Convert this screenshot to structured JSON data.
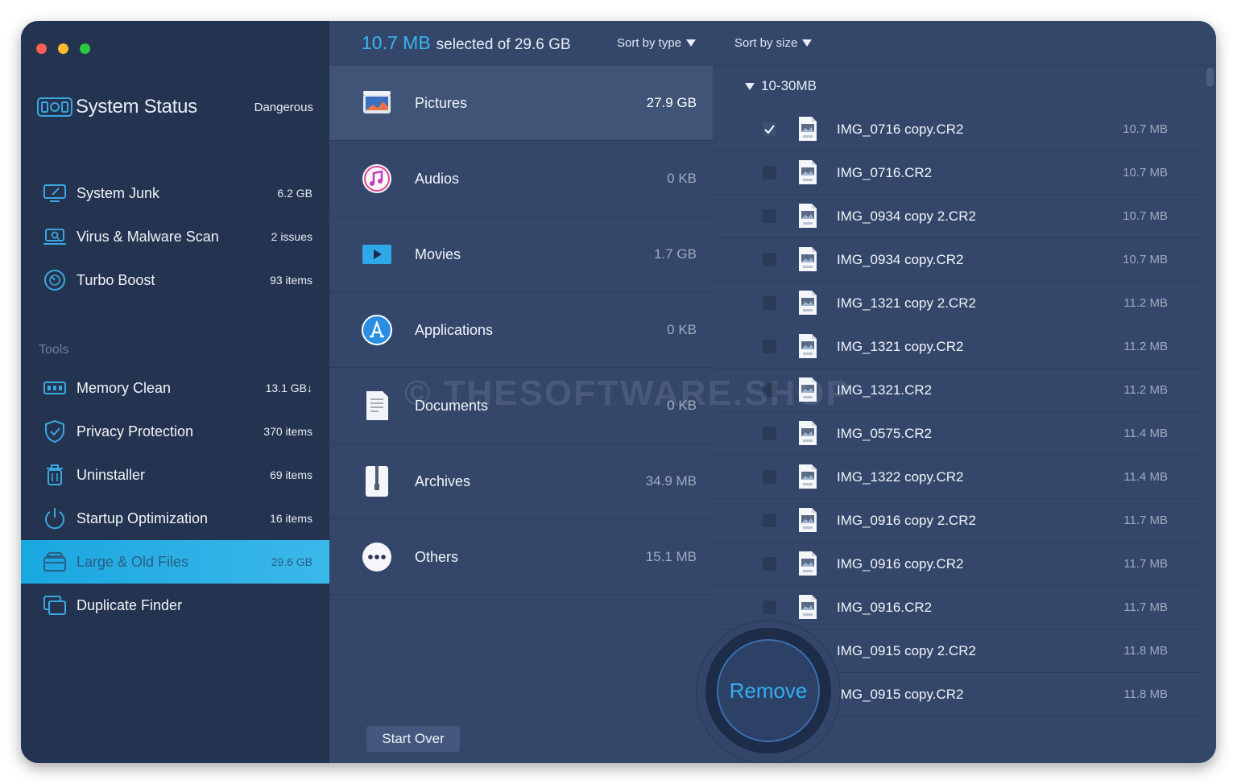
{
  "window": {
    "traffic_lights": [
      "close",
      "minimize",
      "zoom"
    ]
  },
  "sidebar": {
    "status": {
      "title": "System Status",
      "badge": "Dangerous",
      "icon": "status-icon"
    },
    "top_items": [
      {
        "label": "System Junk",
        "value": "6.2 GB",
        "icon": "monitor-broom-icon"
      },
      {
        "label": "Virus & Malware Scan",
        "value": "2 issues",
        "icon": "laptop-scan-icon"
      },
      {
        "label": "Turbo Boost",
        "value": "93 items",
        "icon": "speedometer-icon"
      }
    ],
    "tools_heading": "Tools",
    "tools": [
      {
        "label": "Memory Clean",
        "value": "13.1 GB↓",
        "icon": "memory-chip-icon"
      },
      {
        "label": "Privacy Protection",
        "value": "370 items",
        "icon": "shield-check-icon"
      },
      {
        "label": "Uninstaller",
        "value": "69 items",
        "icon": "trash-icon"
      },
      {
        "label": "Startup Optimization",
        "value": "16 items",
        "icon": "power-icon"
      },
      {
        "label": "Large & Old Files",
        "value": "29.6 GB",
        "icon": "file-box-icon",
        "active": true
      },
      {
        "label": "Duplicate Finder",
        "value": "",
        "icon": "duplicate-folder-icon"
      }
    ]
  },
  "summary": {
    "selected": "10.7 MB",
    "text": "selected of 29.6 GB"
  },
  "sort_type_label": "Sort by type",
  "sort_size_label": "Sort by size",
  "categories": [
    {
      "label": "Pictures",
      "size": "27.9 GB",
      "icon": "pictures-icon",
      "active": true
    },
    {
      "label": "Audios",
      "size": "0 KB",
      "icon": "music-icon"
    },
    {
      "label": "Movies",
      "size": "1.7 GB",
      "icon": "movie-play-icon"
    },
    {
      "label": "Applications",
      "size": "0 KB",
      "icon": "app-store-icon"
    },
    {
      "label": "Documents",
      "size": "0 KB",
      "icon": "document-icon"
    },
    {
      "label": "Archives",
      "size": "34.9 MB",
      "icon": "archive-zip-icon"
    },
    {
      "label": "Others",
      "size": "15.1 MB",
      "icon": "more-dots-icon"
    }
  ],
  "group_label": "10-30MB",
  "files": [
    {
      "name": "IMG_0716 copy.CR2",
      "size": "10.7 MB",
      "checked": true
    },
    {
      "name": "IMG_0716.CR2",
      "size": "10.7 MB",
      "checked": false
    },
    {
      "name": "IMG_0934 copy 2.CR2",
      "size": "10.7 MB",
      "checked": false
    },
    {
      "name": "IMG_0934 copy.CR2",
      "size": "10.7 MB",
      "checked": false
    },
    {
      "name": "IMG_1321 copy 2.CR2",
      "size": "11.2 MB",
      "checked": false
    },
    {
      "name": "IMG_1321 copy.CR2",
      "size": "11.2 MB",
      "checked": false
    },
    {
      "name": "IMG_1321.CR2",
      "size": "11.2 MB",
      "checked": false
    },
    {
      "name": "IMG_0575.CR2",
      "size": "11.4 MB",
      "checked": false
    },
    {
      "name": "IMG_1322 copy.CR2",
      "size": "11.4 MB",
      "checked": false
    },
    {
      "name": "IMG_0916 copy 2.CR2",
      "size": "11.7 MB",
      "checked": false
    },
    {
      "name": "IMG_0916 copy.CR2",
      "size": "11.7 MB",
      "checked": false
    },
    {
      "name": "IMG_0916.CR2",
      "size": "11.7 MB",
      "checked": false
    },
    {
      "name": "IMG_0915 copy 2.CR2",
      "size": "11.8 MB",
      "checked": false
    },
    {
      "name": "IMG_0915 copy.CR2",
      "size": "11.8 MB",
      "checked": false
    }
  ],
  "remove_label": "Remove",
  "start_over_label": "Start Over",
  "watermark": "© THESOFTWARE.SHOP",
  "colors": {
    "accent": "#38b6ee",
    "active_tool": "#1aa7df",
    "sidebar_bg": "#24334f",
    "panel_bg": "#34476a"
  }
}
